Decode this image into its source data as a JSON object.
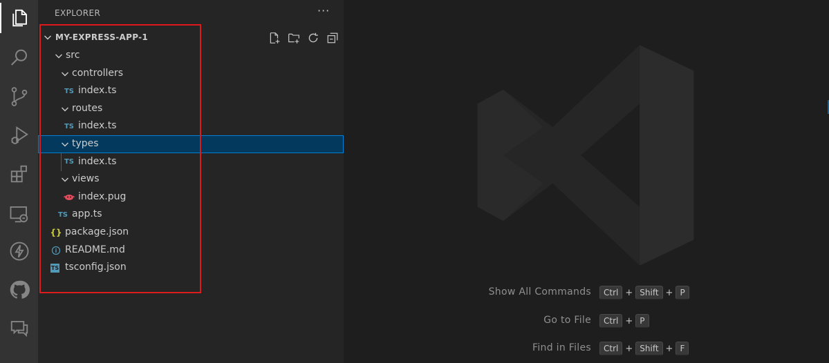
{
  "activity_bar": {
    "icons": [
      "files-icon",
      "search-icon",
      "source-control-icon",
      "run-debug-icon",
      "extensions-icon",
      "remote-explorer-icon",
      "azure-icon",
      "github-icon",
      "feedback-icon"
    ]
  },
  "sidebar": {
    "header": "EXPLORER",
    "more": "···",
    "section": "MY-EXPRESS-APP-1",
    "tree": [
      {
        "label": "src",
        "type": "folder",
        "depth": 1
      },
      {
        "label": "controllers",
        "type": "folder",
        "depth": 2
      },
      {
        "label": "index.ts",
        "type": "ts",
        "depth": 3,
        "icon": "TS"
      },
      {
        "label": "routes",
        "type": "folder",
        "depth": 2
      },
      {
        "label": "index.ts",
        "type": "ts",
        "depth": 3,
        "icon": "TS"
      },
      {
        "label": "types",
        "type": "folder",
        "depth": 2,
        "selected": true
      },
      {
        "label": "index.ts",
        "type": "ts",
        "depth": 3,
        "icon": "TS"
      },
      {
        "label": "views",
        "type": "folder",
        "depth": 2
      },
      {
        "label": "index.pug",
        "type": "pug",
        "depth": 3
      },
      {
        "label": "app.ts",
        "type": "ts",
        "depth": 2,
        "icon": "TS"
      },
      {
        "label": "package.json",
        "type": "json",
        "depth": 1,
        "icon": "{}"
      },
      {
        "label": "README.md",
        "type": "info",
        "depth": 1,
        "icon": "i"
      },
      {
        "label": "tsconfig.json",
        "type": "tsconfig",
        "depth": 1,
        "icon": "TS"
      }
    ]
  },
  "editor": {
    "shortcuts": [
      {
        "label": "Show All Commands",
        "keys": [
          "Ctrl",
          "Shift",
          "P"
        ]
      },
      {
        "label": "Go to File",
        "keys": [
          "Ctrl",
          "P"
        ]
      },
      {
        "label": "Find in Files",
        "keys": [
          "Ctrl",
          "Shift",
          "F"
        ]
      }
    ],
    "plus": "+"
  },
  "colors": {
    "activity_bar": "#333333",
    "sidebar": "#252526",
    "editor": "#1e1e1e",
    "selection": "#04395e",
    "highlight_box": "#e0191b",
    "ts": "#519aba",
    "json": "#cbcb41",
    "pug": "#e34c5c"
  }
}
